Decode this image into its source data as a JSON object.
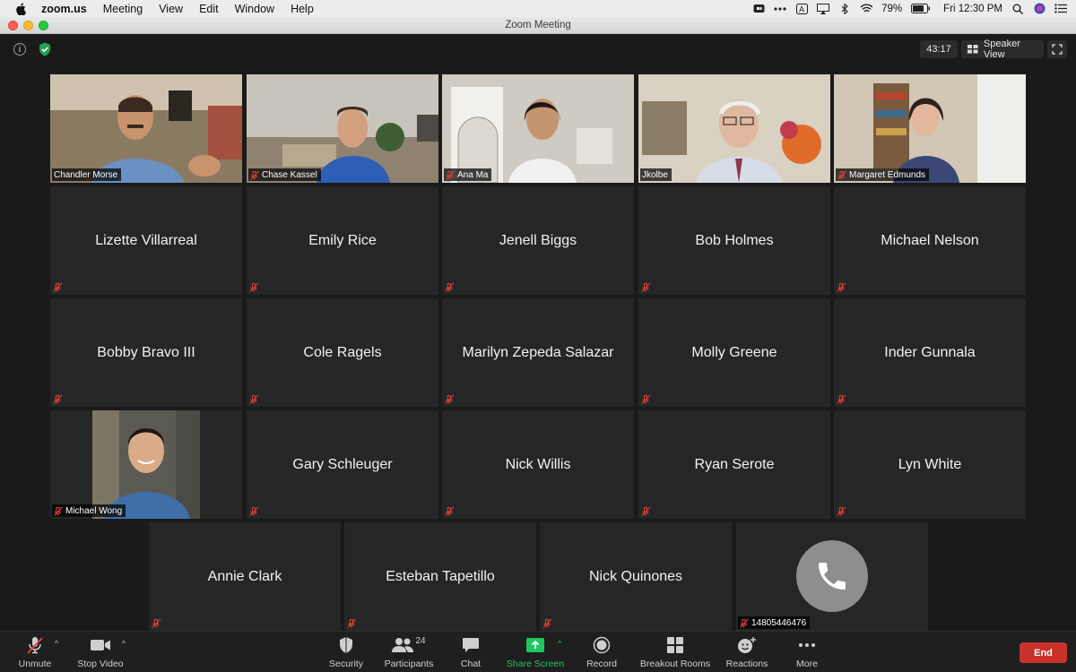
{
  "menubar": {
    "app": "zoom.us",
    "items": [
      "Meeting",
      "View",
      "Edit",
      "Window",
      "Help"
    ],
    "battery": "79%",
    "clock": "Fri 12:30 PM"
  },
  "window": {
    "title": "Zoom Meeting"
  },
  "meeting": {
    "timer": "43:17",
    "view_label": "Speaker View"
  },
  "participants": {
    "video": [
      {
        "name": "Chandler Morse",
        "active": true
      },
      {
        "name": "Chase Kassel"
      },
      {
        "name": "Ana Ma"
      },
      {
        "name": "Jkolbe"
      },
      {
        "name": "Margaret Edmunds"
      }
    ],
    "row2": [
      "Lizette Villarreal",
      "Emily Rice",
      "Jenell Biggs",
      "Bob Holmes",
      "Michael Nelson"
    ],
    "row3": [
      "Bobby Bravo III",
      "Cole Ragels",
      "Marilyn Zepeda Salazar",
      "Molly Greene",
      "Inder Gunnala"
    ],
    "row4_video": "Michael Wong",
    "row4": [
      "Gary Schleuger",
      "Nick Willis",
      "Ryan Serote",
      "Lyn White"
    ],
    "row5": [
      "Annie Clark",
      "Esteban Tapetillo",
      "Nick Quinones"
    ],
    "phone_caller": "14805446476"
  },
  "toolbar": {
    "unmute": "Unmute",
    "stop_video": "Stop Video",
    "security": "Security",
    "participants": "Participants",
    "participant_count": "24",
    "chat": "Chat",
    "share_screen": "Share Screen",
    "record": "Record",
    "breakout_rooms": "Breakout Rooms",
    "reactions": "Reactions",
    "more": "More",
    "end": "End"
  },
  "colors": {
    "active_speaker_border": "#e4e27a",
    "share_screen_green": "#1fc65f",
    "mute_red": "#e0413b",
    "end_red": "#c8322a"
  }
}
